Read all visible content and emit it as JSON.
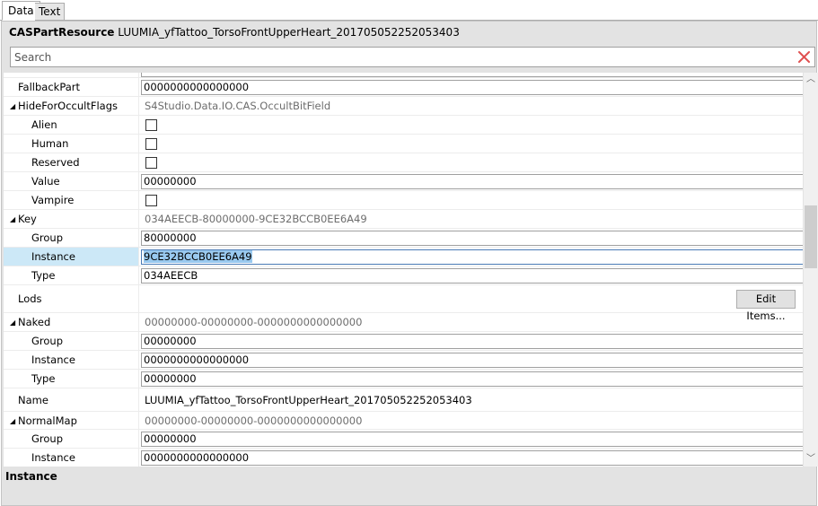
{
  "tabs": [
    {
      "label": "Data",
      "active": true
    },
    {
      "label": "Text",
      "active": false
    }
  ],
  "header": {
    "resource_type": "CASPartResource",
    "resource_name": "LUUMIA_yfTattoo_TorsoFrontUpperHeart_201705052252053403"
  },
  "search": {
    "placeholder": "Search"
  },
  "grid": {
    "rows": [
      {
        "label": "FallbackPart",
        "value": "0000000000000000"
      },
      {
        "label": "HideForOccultFlags",
        "summary": "S4Studio.Data.IO.CAS.OccultBitField"
      },
      {
        "label": "Alien",
        "checked": false
      },
      {
        "label": "Human",
        "checked": false
      },
      {
        "label": "Reserved",
        "checked": false
      },
      {
        "label": "Value",
        "value": "00000000"
      },
      {
        "label": "Vampire",
        "checked": false
      },
      {
        "label": "Key",
        "summary": "034AEECB-80000000-9CE32BCCB0EE6A49"
      },
      {
        "label": "Group",
        "value": "80000000"
      },
      {
        "label": "Instance",
        "value": "9CE32BCCB0EE6A49"
      },
      {
        "label": "Type",
        "value": "034AEECB"
      },
      {
        "label": "Lods",
        "button": "Edit Items..."
      },
      {
        "label": "Naked",
        "summary": "00000000-00000000-0000000000000000"
      },
      {
        "label": "Group",
        "value": "00000000"
      },
      {
        "label": "Instance",
        "value": "0000000000000000"
      },
      {
        "label": "Type",
        "value": "00000000"
      },
      {
        "label": "Name",
        "text": "LUUMIA_yfTattoo_TorsoFrontUpperHeart_201705052252053403"
      },
      {
        "label": "NormalMap",
        "summary": "00000000-00000000-0000000000000000"
      },
      {
        "label": "Group",
        "value": "00000000"
      },
      {
        "label": "Instance",
        "value": "0000000000000000"
      }
    ]
  },
  "description": {
    "title": "Instance"
  },
  "icons": {
    "clear": "close-icon",
    "expand": "triangle-expanded-icon"
  },
  "colors": {
    "selection": "#cce8f7",
    "text_selection": "#99c9ef",
    "clear_icon": "#e05050"
  }
}
